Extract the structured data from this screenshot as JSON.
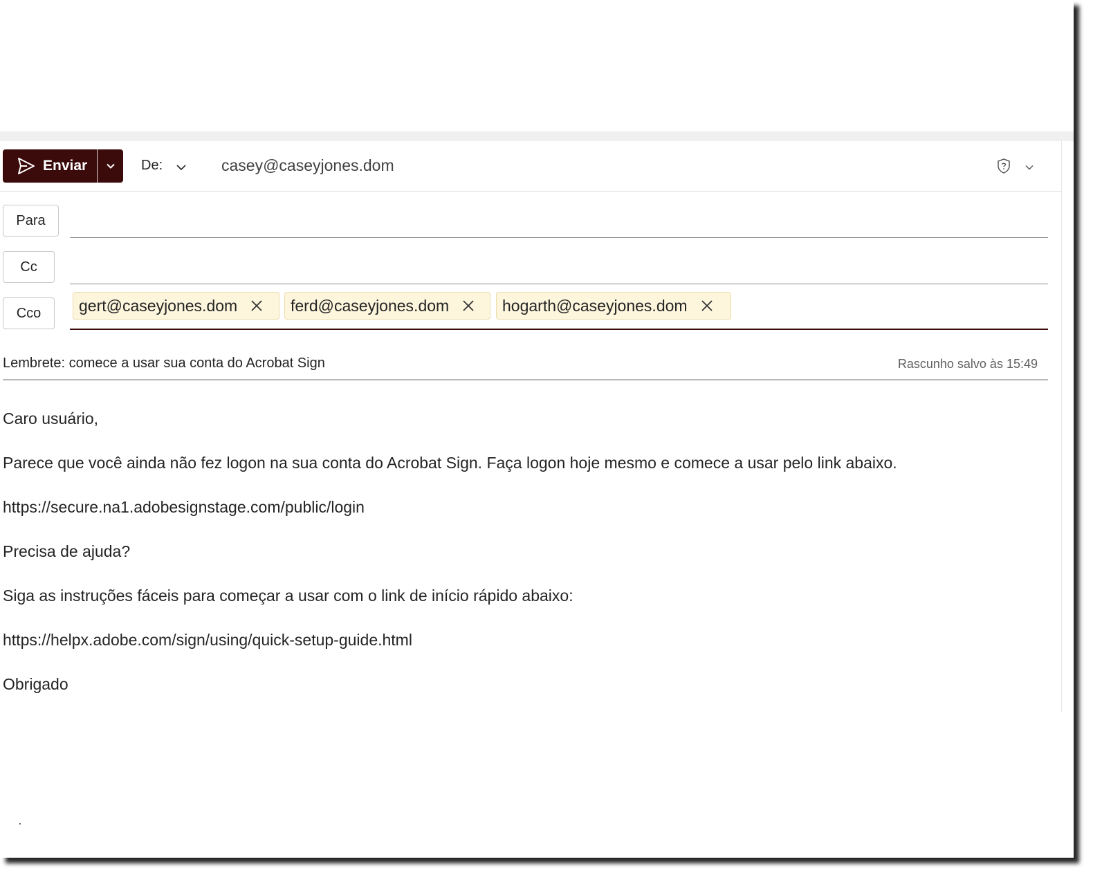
{
  "toolbar": {
    "send_label": "Enviar",
    "from_label": "De:",
    "from_email": "casey@caseyjones.dom"
  },
  "recipients": {
    "to_label": "Para",
    "cc_label": "Cc",
    "bcc_label": "Cco",
    "bcc": [
      "gert@caseyjones.dom",
      "ferd@caseyjones.dom",
      "hogarth@caseyjones.dom"
    ]
  },
  "subject": "Lembrete: comece a usar sua conta do Acrobat Sign",
  "draft_status": "Rascunho salvo às 15:49",
  "body": [
    "Caro usuário,",
    "Parece que você ainda não fez logon na sua conta do Acrobat Sign. Faça logon hoje mesmo e comece a usar pelo link abaixo.",
    "https://secure.na1.adobesignstage.com/public/login",
    "Precisa de ajuda?",
    "Siga as instruções fáceis para começar a usar com o link de início rápido abaixo:",
    "https://helpx.adobe.com/sign/using/quick-setup-guide.html",
    "Obrigado"
  ],
  "colors": {
    "accent": "#3b0a0a",
    "chip_bg": "#fdf6dd"
  },
  "icons": [
    "send-icon",
    "chevron-down-icon",
    "shield-icon",
    "close-icon"
  ]
}
